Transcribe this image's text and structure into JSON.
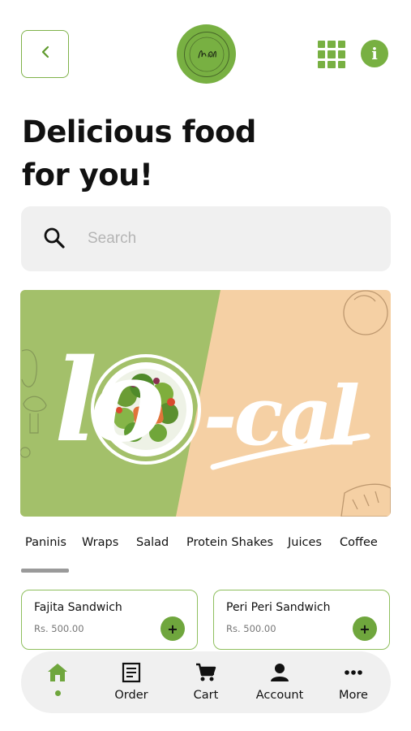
{
  "header": {
    "logo_alt": "Lo-Cal",
    "back_icon": "chevron-left-icon",
    "grid_icon": "grid-icon",
    "info_icon": "info-icon",
    "info_glyph": "i"
  },
  "hero": {
    "headline_line1": "Delicious food",
    "headline_line2": "for you!"
  },
  "search": {
    "placeholder": "Search",
    "value": ""
  },
  "banner": {
    "wordmark_part1": "lo",
    "wordmark_part2": "-cal",
    "colors": {
      "left": "#a3c06a",
      "right": "#f5d0a4",
      "text": "#ffffff"
    }
  },
  "categories": [
    {
      "label": "Paninis",
      "active": true
    },
    {
      "label": "Wraps",
      "active": false
    },
    {
      "label": "Salad",
      "active": false
    },
    {
      "label": "Protein Shakes",
      "active": false
    },
    {
      "label": "Juices",
      "active": false
    },
    {
      "label": "Coffee",
      "active": false
    }
  ],
  "products": [
    {
      "name": "Fajita Sandwich",
      "price": "Rs. 500.00",
      "add_label": "+"
    },
    {
      "name": "Peri Peri Sandwich",
      "price": "Rs. 500.00",
      "add_label": "+"
    }
  ],
  "nav": {
    "items": [
      {
        "label": "",
        "icon": "home-icon",
        "active": true
      },
      {
        "label": "Order",
        "icon": "order-icon",
        "active": false
      },
      {
        "label": "Cart",
        "icon": "cart-icon",
        "active": false
      },
      {
        "label": "Account",
        "icon": "account-icon",
        "active": false
      },
      {
        "label": "More",
        "icon": "more-icon",
        "active": false
      }
    ]
  },
  "colors": {
    "accent": "#78b042",
    "accent_dark": "#6fa63d",
    "surface": "#f0f0f0"
  }
}
